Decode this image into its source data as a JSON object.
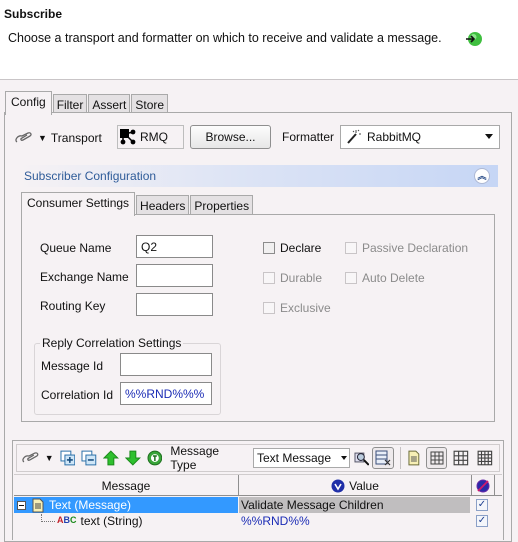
{
  "header": {
    "title": "Subscribe",
    "description": "Choose a transport and formatter on which to receive and validate a message.",
    "icon": "green-arrow-go-icon"
  },
  "tabs": [
    {
      "label": "Config",
      "active": true
    },
    {
      "label": "Filter",
      "active": false
    },
    {
      "label": "Assert",
      "active": false
    },
    {
      "label": "Store",
      "active": false
    }
  ],
  "transport": {
    "label": "Transport",
    "value": "RMQ",
    "browse_label": "Browse...",
    "formatter_label": "Formatter",
    "formatter_value": "RabbitMQ"
  },
  "subscriber_config": {
    "title": "Subscriber Configuration",
    "subtabs": [
      {
        "label": "Consumer Settings",
        "active": true
      },
      {
        "label": "Headers",
        "active": false
      },
      {
        "label": "Properties",
        "active": false
      }
    ],
    "fields": {
      "queue_name": {
        "label": "Queue Name",
        "value": "Q2"
      },
      "exchange_name": {
        "label": "Exchange Name",
        "value": ""
      },
      "routing_key": {
        "label": "Routing Key",
        "value": ""
      }
    },
    "checkboxes": {
      "declare": {
        "label": "Declare",
        "checked": false,
        "enabled": true
      },
      "passive_declaration": {
        "label": "Passive Declaration",
        "checked": false,
        "enabled": false
      },
      "durable": {
        "label": "Durable",
        "checked": false,
        "enabled": false
      },
      "auto_delete": {
        "label": "Auto Delete",
        "checked": false,
        "enabled": false
      },
      "exclusive": {
        "label": "Exclusive",
        "checked": false,
        "enabled": false
      }
    },
    "reply": {
      "title": "Reply Correlation Settings",
      "message_id": {
        "label": "Message Id",
        "value": ""
      },
      "correlation_id": {
        "label": "Correlation Id",
        "value": "%%RND%%%"
      }
    }
  },
  "message": {
    "type_label": "Message Type",
    "type_value": "Text Message",
    "columns": {
      "message": "Message",
      "value": "Value"
    },
    "rows": [
      {
        "name": "Text (Message)",
        "value": "Validate Message Children",
        "checked": true,
        "check_mark": "✓"
      },
      {
        "name": "text (String)",
        "value": "%%RND%%",
        "checked": true,
        "check_mark": "✓"
      }
    ]
  },
  "colors": {
    "selection": "#3399ff",
    "section_title": "#2f5c99",
    "expression_text": "#1a2bb5"
  }
}
